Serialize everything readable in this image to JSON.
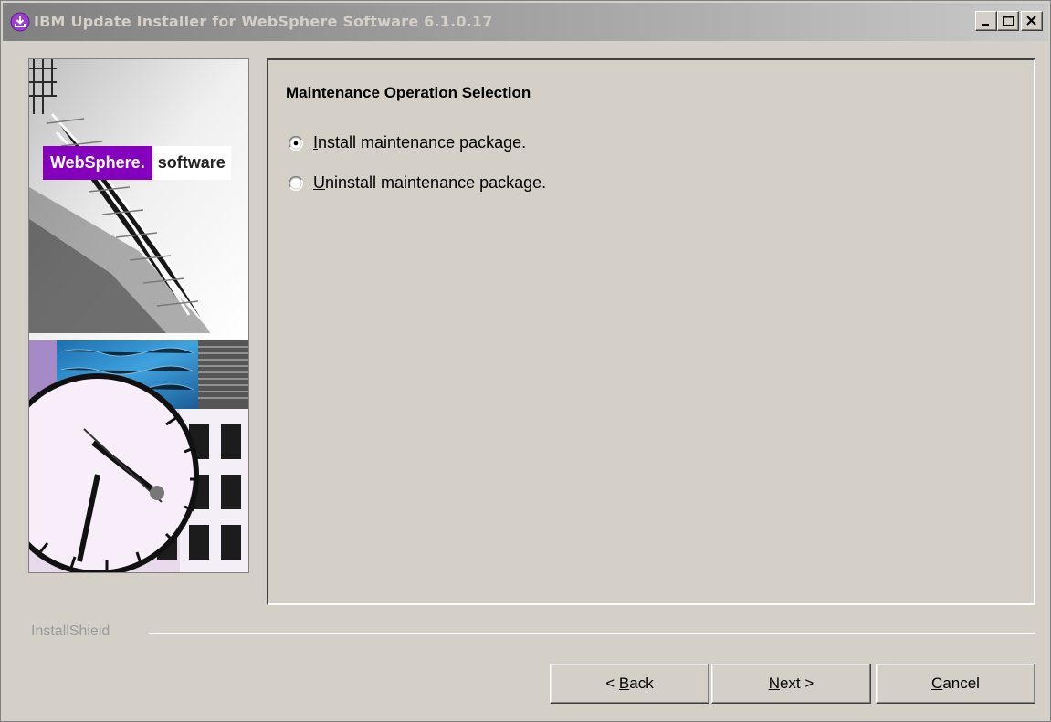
{
  "window": {
    "title": "IBM Update Installer for WebSphere Software 6.1.0.17"
  },
  "banner": {
    "brand_highlight": "WebSphere.",
    "brand_rest": "software"
  },
  "panel": {
    "title": "Maintenance Operation Selection",
    "options": [
      {
        "mnemonic": "I",
        "rest": "nstall maintenance package.",
        "selected": true
      },
      {
        "mnemonic": "U",
        "rest": "ninstall maintenance package.",
        "selected": false
      }
    ]
  },
  "footer": {
    "vendor_label": "InstallShield",
    "back": {
      "prefix": "< ",
      "mnemonic": "B",
      "rest": "ack"
    },
    "next": {
      "mnemonic": "N",
      "rest": "ext >"
    },
    "cancel": {
      "mnemonic": "C",
      "rest": "ancel"
    }
  },
  "colors": {
    "websphere_purple": "#8400bd",
    "dialog_gray": "#d4d0c8",
    "title_text": "#d4d0c8"
  },
  "icons": {
    "app": "download-installer-icon",
    "minimize": "minimize-icon",
    "maximize": "maximize-icon",
    "close": "close-icon"
  }
}
